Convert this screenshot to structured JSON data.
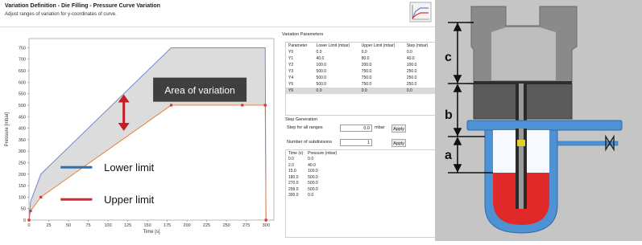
{
  "header": {
    "title": "Variation Definition - Die Filling - Pressure Curve Variation",
    "subtitle": "Adjust ranges of variation for y-coordinates of curve."
  },
  "chart_data": {
    "type": "line",
    "xlabel": "Time [s]",
    "ylabel": "Pressure [mbar]",
    "xlim": [
      0,
      310
    ],
    "ylim": [
      0,
      790
    ],
    "xticks": [
      0,
      25,
      50,
      75,
      100,
      125,
      150,
      175,
      200,
      225,
      250,
      275,
      300
    ],
    "yticks": [
      0,
      50,
      100,
      150,
      200,
      250,
      300,
      350,
      400,
      450,
      500,
      550,
      600,
      650,
      700,
      750
    ],
    "series": [
      {
        "name": "Upper limit",
        "color": "#6b7bd6",
        "x": [
          0,
          2,
          15,
          180,
          270,
          299,
          300
        ],
        "y": [
          0,
          80,
          200,
          750,
          750,
          750,
          0
        ]
      },
      {
        "name": "Lower limit",
        "color": "#e8762c",
        "x": [
          0,
          2,
          15,
          180,
          270,
          299,
          300
        ],
        "y": [
          0,
          40,
          100,
          500,
          500,
          500,
          0
        ]
      },
      {
        "name": "Points",
        "color": "#e03030",
        "x": [
          0,
          2,
          15,
          180,
          270,
          299,
          300
        ],
        "y": [
          0,
          40,
          100,
          500,
          500,
          500,
          0
        ]
      }
    ],
    "annotation": "Area of variation",
    "legend": [
      {
        "label": "Lower limit",
        "color": "#2c6fb7"
      },
      {
        "label": "Upper limit",
        "color": "#d6282b"
      }
    ]
  },
  "params": {
    "title": "Variation Parameters",
    "columns": [
      "Parameter",
      "Lower Limit (mbar)",
      "Upper Limit (mbar)",
      "Step (mbar)"
    ],
    "rows": [
      [
        "Y0",
        "0.0",
        "0.0",
        "0.0"
      ],
      [
        "Y1",
        "40.0",
        "80.0",
        "40.0"
      ],
      [
        "Y2",
        "100.0",
        "200.0",
        "100.0"
      ],
      [
        "Y3",
        "500.0",
        "750.0",
        "250.0"
      ],
      [
        "Y4",
        "500.0",
        "750.0",
        "250.0"
      ],
      [
        "Y5",
        "500.0",
        "750.0",
        "250.0"
      ],
      [
        "Y6",
        "0.0",
        "0.0",
        "0.0"
      ]
    ],
    "selected_row": 6
  },
  "step_generation": {
    "title": "Step Generation",
    "step_label": "Step for all ranges",
    "step_value": "0.0",
    "step_unit": "mbar",
    "apply_label": "Apply",
    "subdiv_label": "Number of subdivisons",
    "subdiv_value": "1"
  },
  "time_table": {
    "columns": [
      "Time (s)",
      "Pressure (mbar)"
    ],
    "rows": [
      [
        "0.0",
        "0.0"
      ],
      [
        "2.0",
        "40.0"
      ],
      [
        "15.0",
        "100.0"
      ],
      [
        "180.0",
        "500.0"
      ],
      [
        "270.0",
        "500.0"
      ],
      [
        "299.0",
        "500.0"
      ],
      [
        "300.0",
        "0.0"
      ]
    ]
  },
  "diagram": {
    "labels": [
      "c",
      "b",
      "a"
    ],
    "colors": {
      "die": "#5c5c5c",
      "die_light": "#8a8a8a",
      "container": "#4f92d4",
      "melt": "#e02a2a",
      "background": "#c5c5c5"
    }
  }
}
